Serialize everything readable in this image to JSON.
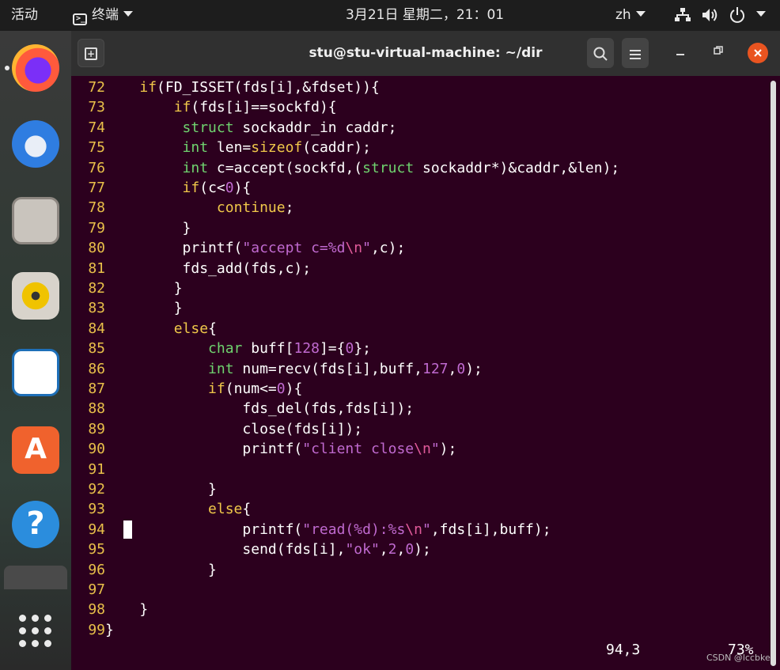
{
  "topbar": {
    "activities": "活动",
    "app_name": "终端",
    "clock": "3月21日 星期二，21：01",
    "language": "zh"
  },
  "dock": {
    "apps": [
      "firefox-icon",
      "thunderbird-icon",
      "files-icon",
      "rhythmbox-icon",
      "writer-icon",
      "software-icon",
      "help-icon",
      "terminal-icon",
      "app-grid-icon"
    ],
    "software_glyph": "A",
    "help_glyph": "?"
  },
  "window": {
    "title": "stu@stu-virtual-machine: ~/dir"
  },
  "editor": {
    "lines": [
      {
        "n": "72",
        "tokens": [
          [
            "p",
            "    "
          ],
          [
            "kw",
            "if"
          ],
          [
            "p",
            "(FD_ISSET(fds[i],&fdset)){"
          ]
        ]
      },
      {
        "n": "73",
        "tokens": [
          [
            "p",
            "        "
          ],
          [
            "kw",
            "if"
          ],
          [
            "p",
            "(fds[i]==sockfd){"
          ]
        ]
      },
      {
        "n": "74",
        "tokens": [
          [
            "p",
            "         "
          ],
          [
            "ty",
            "struct"
          ],
          [
            "p",
            " sockaddr_in caddr;"
          ]
        ]
      },
      {
        "n": "75",
        "tokens": [
          [
            "p",
            "         "
          ],
          [
            "ty",
            "int"
          ],
          [
            "p",
            " len="
          ],
          [
            "kw",
            "sizeof"
          ],
          [
            "p",
            "(caddr);"
          ]
        ]
      },
      {
        "n": "76",
        "tokens": [
          [
            "p",
            "         "
          ],
          [
            "ty",
            "int"
          ],
          [
            "p",
            " c=accept(sockfd,("
          ],
          [
            "ty",
            "struct"
          ],
          [
            "p",
            " sockaddr*)&caddr,&len);"
          ]
        ]
      },
      {
        "n": "77",
        "tokens": [
          [
            "p",
            "         "
          ],
          [
            "kw",
            "if"
          ],
          [
            "p",
            "(c<"
          ],
          [
            "num",
            "0"
          ],
          [
            "p",
            "){"
          ]
        ]
      },
      {
        "n": "78",
        "tokens": [
          [
            "p",
            "             "
          ],
          [
            "kw",
            "continue"
          ],
          [
            "p",
            ";"
          ]
        ]
      },
      {
        "n": "79",
        "tokens": [
          [
            "p",
            "         }"
          ]
        ]
      },
      {
        "n": "80",
        "tokens": [
          [
            "p",
            "         printf("
          ],
          [
            "str",
            "\"accept c=%d"
          ],
          [
            "esc",
            "\\n"
          ],
          [
            "str",
            "\""
          ],
          [
            "p",
            ",c);"
          ]
        ]
      },
      {
        "n": "81",
        "tokens": [
          [
            "p",
            "         fds_add(fds,c);"
          ]
        ]
      },
      {
        "n": "82",
        "tokens": [
          [
            "p",
            "        }"
          ]
        ]
      },
      {
        "n": "83",
        "tokens": [
          [
            "p",
            "        }"
          ]
        ]
      },
      {
        "n": "84",
        "tokens": [
          [
            "p",
            "        "
          ],
          [
            "kw",
            "else"
          ],
          [
            "p",
            "{"
          ]
        ]
      },
      {
        "n": "85",
        "tokens": [
          [
            "p",
            "            "
          ],
          [
            "ty",
            "char"
          ],
          [
            "p",
            " buff["
          ],
          [
            "num",
            "128"
          ],
          [
            "p",
            "]={"
          ],
          [
            "num",
            "0"
          ],
          [
            "p",
            "};"
          ]
        ]
      },
      {
        "n": "86",
        "tokens": [
          [
            "p",
            "            "
          ],
          [
            "ty",
            "int"
          ],
          [
            "p",
            " num=recv(fds[i],buff,"
          ],
          [
            "num",
            "127"
          ],
          [
            "p",
            ","
          ],
          [
            "num",
            "0"
          ],
          [
            "p",
            ");"
          ]
        ]
      },
      {
        "n": "87",
        "tokens": [
          [
            "p",
            "            "
          ],
          [
            "kw",
            "if"
          ],
          [
            "p",
            "(num<="
          ],
          [
            "num",
            "0"
          ],
          [
            "p",
            "){"
          ]
        ]
      },
      {
        "n": "88",
        "tokens": [
          [
            "p",
            "                fds_del(fds,fds[i]);"
          ]
        ]
      },
      {
        "n": "89",
        "tokens": [
          [
            "p",
            "                close(fds[i]);"
          ]
        ]
      },
      {
        "n": "90",
        "tokens": [
          [
            "p",
            "                printf("
          ],
          [
            "str",
            "\"client close"
          ],
          [
            "esc",
            "\\n"
          ],
          [
            "str",
            "\""
          ],
          [
            "p",
            ");"
          ]
        ]
      },
      {
        "n": "91",
        "tokens": [
          [
            "p",
            ""
          ]
        ]
      },
      {
        "n": "92",
        "tokens": [
          [
            "p",
            "            }"
          ]
        ]
      },
      {
        "n": "93",
        "tokens": [
          [
            "p",
            "            "
          ],
          [
            "kw",
            "else"
          ],
          [
            "p",
            "{"
          ]
        ]
      },
      {
        "n": "94",
        "tokens": [
          [
            "p",
            "                printf("
          ],
          [
            "str",
            "\"read(%d):%s"
          ],
          [
            "esc",
            "\\n"
          ],
          [
            "str",
            "\""
          ],
          [
            "p",
            ",fds[i],buff);"
          ]
        ]
      },
      {
        "n": "95",
        "tokens": [
          [
            "p",
            "                send(fds[i],"
          ],
          [
            "str",
            "\"ok\""
          ],
          [
            "p",
            ","
          ],
          [
            "num",
            "2"
          ],
          [
            "p",
            ","
          ],
          [
            "num",
            "0"
          ],
          [
            "p",
            ");"
          ]
        ]
      },
      {
        "n": "96",
        "tokens": [
          [
            "p",
            "            }"
          ]
        ]
      },
      {
        "n": "97",
        "tokens": [
          [
            "p",
            ""
          ]
        ]
      },
      {
        "n": "98",
        "tokens": [
          [
            "p",
            "    }"
          ]
        ]
      },
      {
        "n": "99",
        "tokens": [
          [
            "p",
            "}"
          ]
        ]
      }
    ],
    "status_position": "94,3",
    "status_percent": "73%"
  },
  "watermark": "CSDN @lccbke",
  "colors": {
    "terminal_bg": "#2c001e",
    "line_number": "#e9c04a",
    "keyword": "#f0c84a",
    "type": "#6fd36f",
    "literal": "#c06ad0",
    "close_button": "#e95420"
  }
}
